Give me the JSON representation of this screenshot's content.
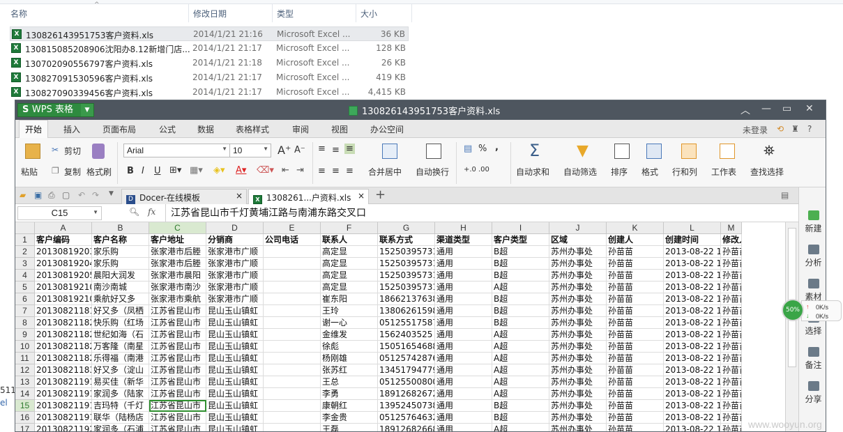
{
  "explorer": {
    "columns": [
      "名称",
      "修改日期",
      "类型",
      "大小"
    ],
    "files": [
      {
        "name": "130826143951753客户资料.xls",
        "date": "2014/1/21 21:16",
        "type": "Microsoft Excel ...",
        "size": "36 KB"
      },
      {
        "name": "130815085208906沈阳办8.12新增门店...",
        "date": "2014/1/21 21:17",
        "type": "Microsoft Excel ...",
        "size": "128 KB"
      },
      {
        "name": "130702090556797客户资料.xls",
        "date": "2014/1/21 21:18",
        "type": "Microsoft Excel ...",
        "size": "26 KB"
      },
      {
        "name": "130827091530596客户资料.xls",
        "date": "2014/1/21 21:17",
        "type": "Microsoft Excel ...",
        "size": "419 KB"
      },
      {
        "name": "130827090339456客户资料.xls",
        "date": "2014/1/21 21:17",
        "type": "Microsoft Excel ...",
        "size": "4,415 KB"
      }
    ],
    "left_edge": [
      "511",
      "el"
    ]
  },
  "window": {
    "app_label": "WPS 表格",
    "title": "130826143951753客户资料.xls",
    "controls": [
      "︿",
      "—",
      "▭",
      "✕"
    ]
  },
  "menu": {
    "items": [
      "开始",
      "插入",
      "页面布局",
      "公式",
      "数据",
      "表格样式",
      "审阅",
      "视图",
      "办公空间"
    ],
    "login": "未登录",
    "help": "?"
  },
  "ribbon": {
    "paste": "粘贴",
    "cut": "剪切",
    "copy": "复制",
    "format_painter": "格式刷",
    "font": "Arial",
    "size": "10",
    "bold": "B",
    "italic": "I",
    "underline": "U",
    "merge": "合并居中",
    "wrap": "自动换行",
    "percent": "%",
    "comma": ",",
    "autosum": "自动求和",
    "autofilter": "自动筛选",
    "sort": "排序",
    "format": "格式",
    "rowcol": "行和列",
    "sheet": "工作表",
    "findselect": "查找选择"
  },
  "doctabs": {
    "tab1": "Docer-在线模板",
    "tab2": "1308261...户资料.xls",
    "close": "×",
    "add": "+"
  },
  "formula": {
    "cell_ref": "C15",
    "fx": "fx",
    "value": "江苏省昆山市千灯黄埔江路与南浦东路交叉口"
  },
  "sheet": {
    "col_letters": [
      "A",
      "B",
      "C",
      "D",
      "E",
      "F",
      "G",
      "H",
      "I",
      "J",
      "K",
      "L",
      "M"
    ],
    "row_numbers": [
      "1",
      "2",
      "3",
      "4",
      "5",
      "6",
      "7",
      "8",
      "9",
      "10",
      "11",
      "12",
      "13",
      "14",
      "15",
      "16",
      "17"
    ],
    "headers": [
      "客户编码",
      "客户名称",
      "客户地址",
      "分销商",
      "公司电话",
      "联系人",
      "联系方式",
      "渠道类型",
      "客户类型",
      "区域",
      "创建人",
      "创建时间",
      "修改人"
    ],
    "rows": [
      [
        "201308192035350001",
        "家乐购",
        "张家港市后塍",
        "张家港市广顺",
        "",
        "高定显",
        "15250395731",
        "通用",
        "B超",
        "苏州办事处",
        "孙苗苗",
        "2013-08-22 11",
        "孙苗苗"
      ],
      [
        "201308192049100001",
        "家乐购",
        "张家港市后塍",
        "张家港市广顺",
        "",
        "高定显",
        "15250395731",
        "通用",
        "B超",
        "苏州办事处",
        "孙苗苗",
        "2013-08-22 11",
        "孙苗苗"
      ],
      [
        "201308192058440001",
        "晨阳大润发",
        "张家港市晨阳",
        "张家港市广顺",
        "",
        "高定显",
        "15250395731",
        "通用",
        "B超",
        "苏州办事处",
        "孙苗苗",
        "2013-08-22 11",
        "孙苗苗"
      ],
      [
        "201308192104290001",
        "南沙南城",
        "张家港市南沙",
        "张家港市广顺",
        "",
        "高定显",
        "15250395731",
        "通用",
        "A超",
        "苏州办事处",
        "孙苗苗",
        "2013-08-22 11",
        "孙苗苗"
      ],
      [
        "201308192108120001",
        "乘航好又多",
        "张家港市乘航",
        "张家港市广顺",
        "",
        "崔东阳",
        "18662137638",
        "通用",
        "B超",
        "苏州办事处",
        "孙苗苗",
        "2013-08-22 11",
        "孙苗苗"
      ],
      [
        "201308211819110001",
        "好又多（凤栖",
        "江苏省昆山市",
        "昆山玉山镇虹",
        "",
        "王玲",
        "13806261598",
        "通用",
        "B超",
        "苏州办事处",
        "孙苗苗",
        "2013-08-22 11",
        "孙苗苗"
      ],
      [
        "201308211821290001",
        "快乐购（红场",
        "江苏省昆山市",
        "昆山玉山镇虹",
        "",
        "谢一心",
        "05125517587",
        "通用",
        "B超",
        "苏州办事处",
        "孙苗苗",
        "2013-08-22 11",
        "孙苗苗"
      ],
      [
        "201308211823250001",
        "世纪如海（石",
        "江苏省昆山市",
        "昆山玉山镇虹",
        "",
        "金维发",
        "1562403525",
        "通用",
        "A超",
        "苏州办事处",
        "孙苗苗",
        "2013-08-22 11",
        "孙苗苗"
      ],
      [
        "201308211825140001",
        "万客隆（南星",
        "江苏省昆山市",
        "昆山玉山镇虹",
        "",
        "徐彪",
        "15051654688",
        "通用",
        "A超",
        "苏州办事处",
        "孙苗苗",
        "2013-08-22 11",
        "孙苗苗"
      ],
      [
        "201308211828130001",
        "乐得福（南港",
        "江苏省昆山市",
        "昆山玉山镇虹",
        "",
        "杨刚雄",
        "05125742876",
        "通用",
        "A超",
        "苏州办事处",
        "孙苗苗",
        "2013-08-22 11",
        "孙苗苗"
      ],
      [
        "201308211830180001",
        "好又多（淀山",
        "江苏省昆山市",
        "昆山玉山镇虹",
        "",
        "张苏红",
        "13451794779",
        "通用",
        "A超",
        "苏州办事处",
        "孙苗苗",
        "2013-08-22 11",
        "孙苗苗"
      ],
      [
        "201308211914530001",
        "易买佳（新华",
        "江苏省昆山市",
        "昆山玉山镇虹",
        "",
        "王总",
        "05125500800",
        "通用",
        "A超",
        "苏州办事处",
        "孙苗苗",
        "2013-08-22 11",
        "孙苗苗"
      ],
      [
        "201308211916210001",
        "家润多（陆家",
        "江苏省昆山市",
        "昆山玉山镇虹",
        "",
        "李勇",
        "18912682672",
        "通用",
        "A超",
        "苏州办事处",
        "孙苗苗",
        "2013-08-22 11",
        "孙苗苗"
      ],
      [
        "201308211918220001",
        "吉玛特（千灯",
        "江苏省昆山市",
        "昆山玉山镇虹",
        "",
        "康朝红",
        "13952450738",
        "通用",
        "B超",
        "苏州办事处",
        "孙苗苗",
        "2013-08-22 11",
        "孙苗苗"
      ],
      [
        "201308211919580001",
        "联华（陆杨店",
        "江苏省昆山市",
        "昆山玉山镇虹",
        "",
        "李金贵",
        "05125764632",
        "通用",
        "B超",
        "苏州办事处",
        "孙苗苗",
        "2013-08-22 11",
        "孙苗苗"
      ],
      [
        "201308211921460001",
        "家润多（石浦",
        "江苏省昆山市",
        "昆山玉山镇虹",
        "",
        "王磊",
        "18912682668",
        "通用",
        "A超",
        "苏州办事处",
        "孙苗苗",
        "2013-08-22 11",
        "孙苗苗"
      ]
    ]
  },
  "sidepanel": [
    "新建",
    "分析",
    "素材",
    "选择",
    "备注",
    "分享"
  ],
  "network": {
    "percent": "50%",
    "up": "0K/s",
    "down": "0K/s"
  },
  "watermark": "www.wooyun.org"
}
